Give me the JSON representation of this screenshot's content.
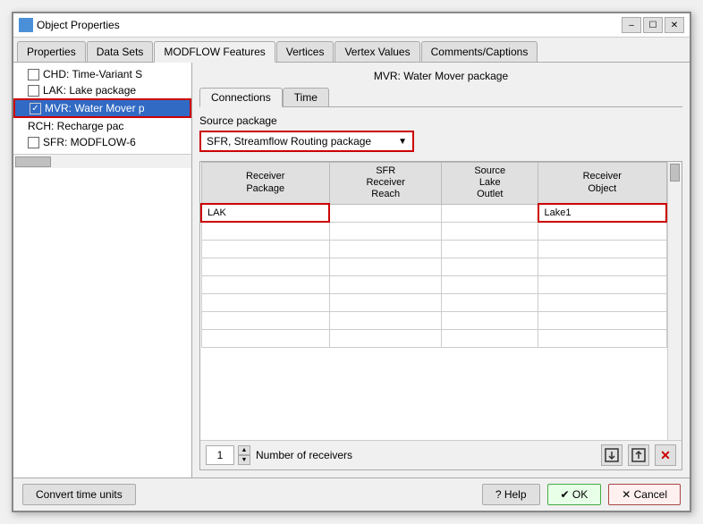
{
  "window": {
    "title": "Object Properties",
    "icon": "properties-icon"
  },
  "tabs": {
    "items": [
      {
        "label": "Properties"
      },
      {
        "label": "Data Sets"
      },
      {
        "label": "MODFLOW Features"
      },
      {
        "label": "Vertices"
      },
      {
        "label": "Vertex Values"
      },
      {
        "label": "Comments/Captions"
      }
    ],
    "active": 2
  },
  "left_panel": {
    "items": [
      {
        "label": "CHD: Time-Variant S",
        "indent": 1,
        "checkbox": false,
        "has_checkbox": true,
        "selected": false
      },
      {
        "label": "LAK: Lake package",
        "indent": 1,
        "checkbox": false,
        "has_checkbox": true,
        "selected": false
      },
      {
        "label": "MVR: Water Mover p",
        "indent": 1,
        "checkbox": true,
        "has_checkbox": true,
        "selected": true
      },
      {
        "label": "RCH: Recharge pac",
        "indent": 1,
        "checkbox": false,
        "has_checkbox": false,
        "selected": false
      },
      {
        "label": "SFR: MODFLOW-6",
        "indent": 1,
        "checkbox": false,
        "has_checkbox": true,
        "selected": false
      }
    ]
  },
  "right_panel": {
    "title": "MVR: Water Mover package",
    "inner_tabs": [
      {
        "label": "Connections"
      },
      {
        "label": "Time"
      }
    ],
    "active_inner_tab": 0,
    "source_package": {
      "label": "Source package",
      "selected": "SFR, Streamflow Routing package"
    },
    "table": {
      "columns": [
        {
          "label": "Receiver\nPackage"
        },
        {
          "label": "SFR\nReceiver\nReach"
        },
        {
          "label": "Source\nLake\nOutlet"
        },
        {
          "label": "Receiver\nObject"
        }
      ],
      "rows": [
        {
          "cells": [
            "LAK",
            "",
            "",
            "Lake1"
          ]
        }
      ]
    },
    "num_receivers": {
      "value": "1",
      "label": "Number of receivers"
    },
    "toolbar_icons": [
      {
        "name": "import-icon",
        "symbol": "⬛"
      },
      {
        "name": "export-icon",
        "symbol": "⬛"
      },
      {
        "name": "delete-icon",
        "symbol": "✕"
      }
    ]
  },
  "bottom_bar": {
    "convert_btn": "Convert time units",
    "help_btn": "? Help",
    "ok_btn": "✔ OK",
    "cancel_btn": "✕ Cancel"
  }
}
